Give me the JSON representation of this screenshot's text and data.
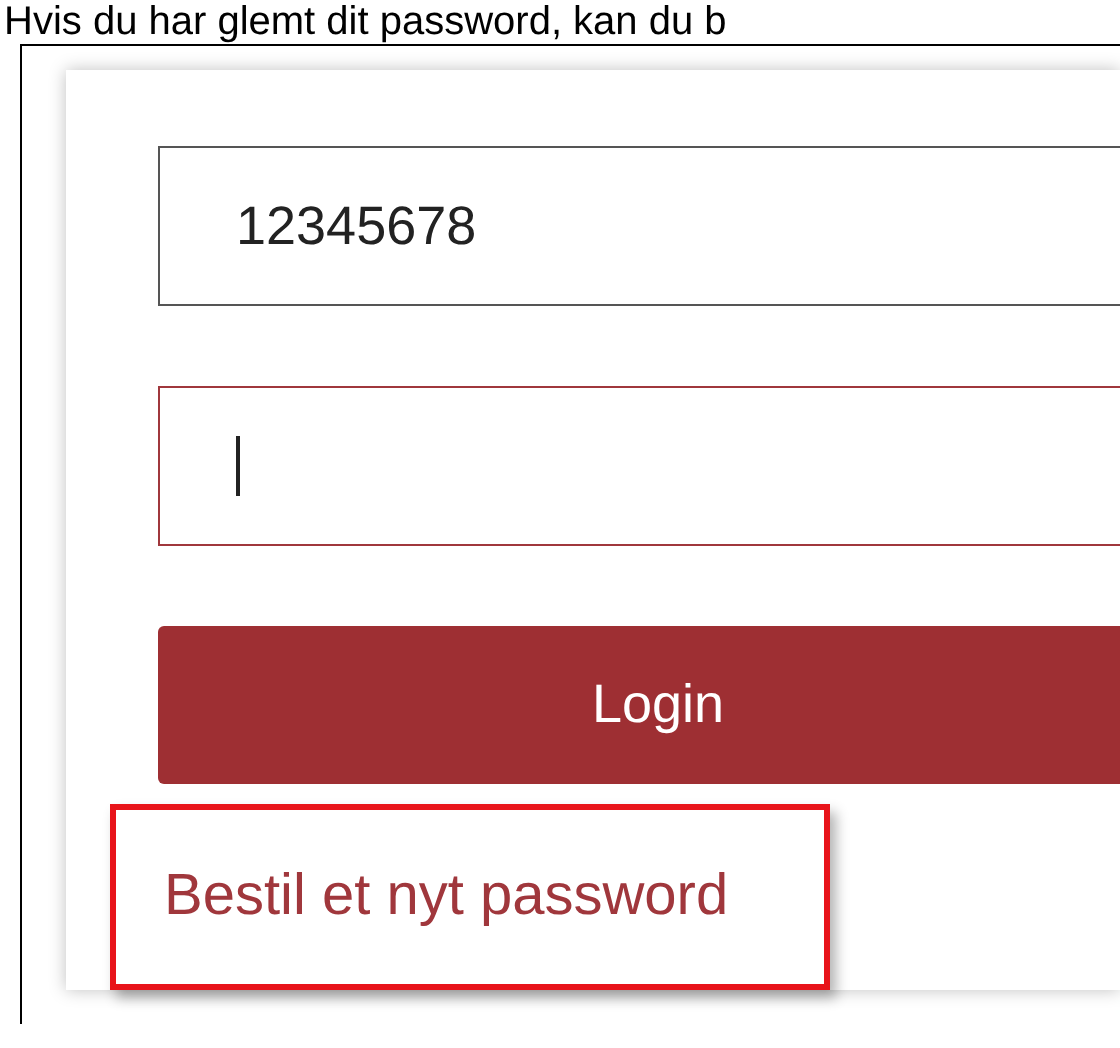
{
  "caption": "Hvis du har glemt dit password, kan du b",
  "username_field": {
    "value": "12345678"
  },
  "password_field": {
    "focused": true
  },
  "login_button": {
    "label": "Login"
  },
  "forgot_password_link": {
    "label": "Bestil et nyt password",
    "highlighted": true
  }
}
